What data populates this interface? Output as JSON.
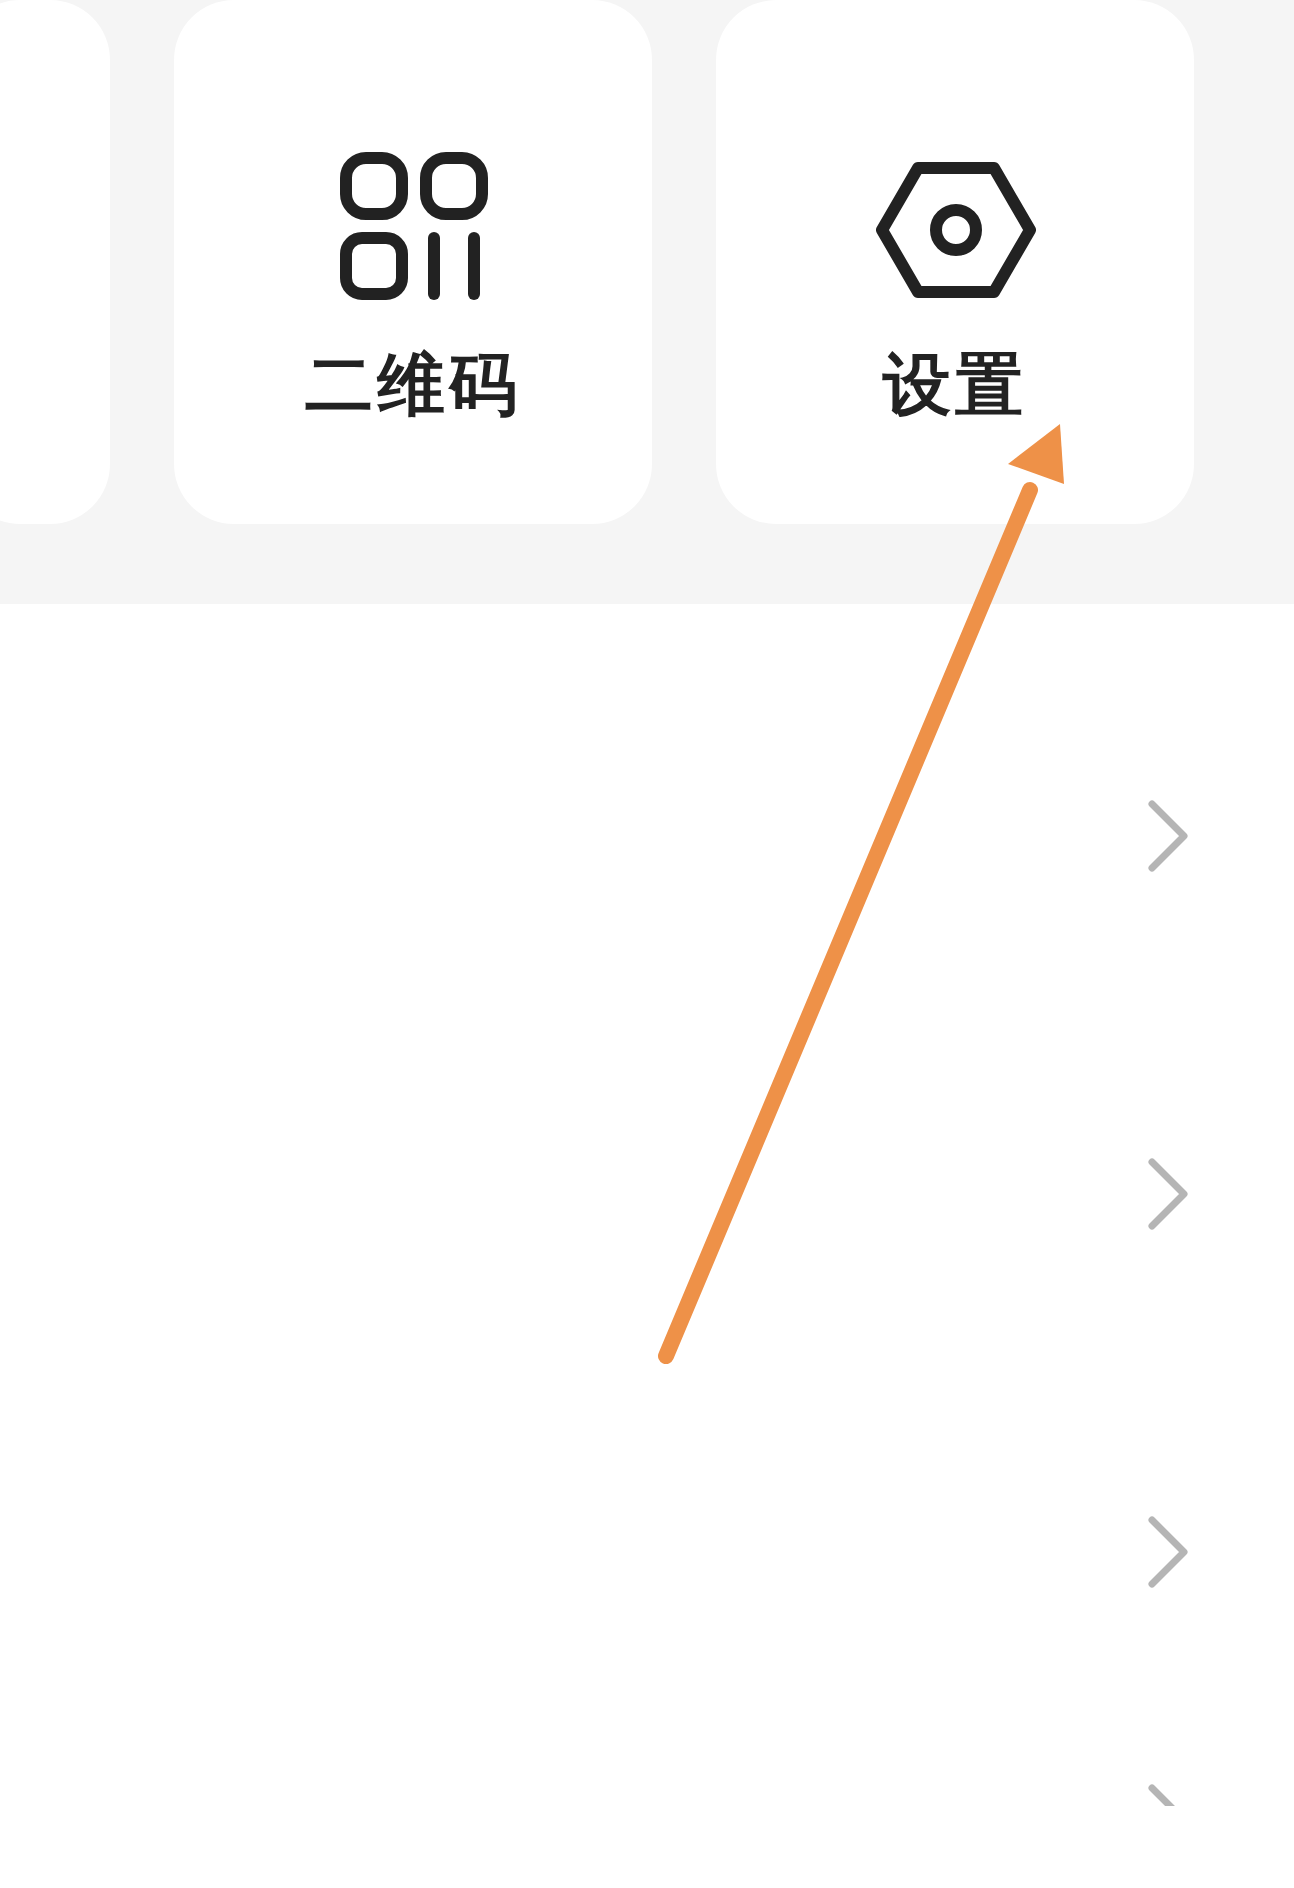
{
  "tiles": [
    {
      "kind": "cut"
    },
    {
      "kind": "qrcode",
      "label": "二维码"
    },
    {
      "kind": "settings",
      "label": "设置"
    }
  ],
  "rows": [
    {
      "kind": "link"
    },
    {
      "kind": "link"
    },
    {
      "kind": "link"
    },
    {
      "kind": "link_cut"
    }
  ],
  "annotation": {
    "kind": "arrow"
  }
}
